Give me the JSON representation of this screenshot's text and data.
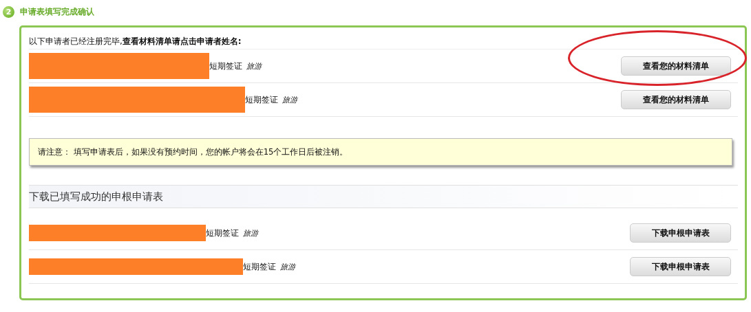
{
  "step": {
    "number": "2",
    "title": "申请表填写完成确认"
  },
  "intro": "以下申请者已经注册完毕,**查看材料清单请点击申请者姓名:**",
  "applicants": [
    {
      "visa_type": "短期签证",
      "purpose": "旅游",
      "button": "查看您的材料清单",
      "circled": true
    },
    {
      "visa_type": "短期签证",
      "purpose": "旅游",
      "button": "查看您的材料清单",
      "circled": false
    }
  ],
  "notice": "请注意： 填写申请表后，如果没有预约时间，您的帐户将会在15个工作日后被注销。",
  "download_section": {
    "title": "下载已填写成功的申根申请表",
    "rows": [
      {
        "visa_type": "短期签证",
        "purpose": "旅游",
        "button": "下载申根申请表"
      },
      {
        "visa_type": "短期签证",
        "purpose": "旅游",
        "button": "下载申根申请表"
      }
    ]
  }
}
